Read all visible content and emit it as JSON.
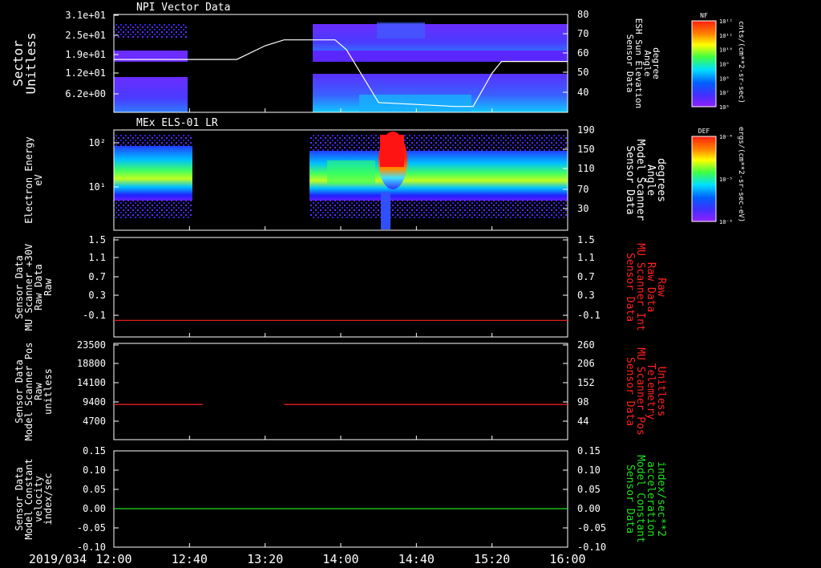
{
  "date_label": "2019/034",
  "time_ticks": [
    "12:00",
    "12:40",
    "13:20",
    "14:00",
    "14:40",
    "15:20",
    "16:00"
  ],
  "colors": {
    "red_series": "#ff2020",
    "green_series": "#20e020",
    "frame": "#ffffff",
    "background": "#000000"
  },
  "panels": [
    {
      "id": "npi",
      "title": "NPI Vector Data",
      "left_label": [
        "Sector",
        "Unitless"
      ],
      "left_ticks": [
        "3.1e+01",
        "2.5e+01",
        "1.9e+01",
        "1.2e+01",
        "6.2e+00"
      ],
      "right_label": [
        "Sensor Data",
        "ESH Sun Elevation",
        "Angle",
        "degree"
      ],
      "right_ticks": [
        "80",
        "70",
        "60",
        "50",
        "40"
      ],
      "colorbar": {
        "label": "NF",
        "unit": "cnts/(cm**2-sr-sec)",
        "ticks": [
          "10¹²",
          "10¹¹",
          "10¹⁰",
          "10⁹",
          "10⁸",
          "10⁷",
          "10⁶"
        ]
      }
    },
    {
      "id": "els",
      "title": "MEx ELS-01 LR",
      "left_label": [
        "Electron Energy",
        "eV"
      ],
      "left_ticks": [
        "10²",
        "10¹"
      ],
      "right_label": [
        "Sensor Data",
        "Model Scanner",
        "Angle",
        "degrees"
      ],
      "right_ticks": [
        "190",
        "150",
        "110",
        "70",
        "30"
      ],
      "colorbar": {
        "label": "DEF",
        "unit": "ergs/(cm**2-sr-sec-eV)",
        "ticks": [
          "10⁻⁴",
          "10⁻⁵",
          "10⁻⁶"
        ]
      }
    },
    {
      "id": "mu_raw",
      "title": "",
      "left_label": [
        "Sensor Data",
        "MU Scanner +30V",
        "Raw Data",
        "Raw"
      ],
      "left_ticks": [
        "1.5",
        "1.1",
        "0.7",
        "0.3",
        "-0.1"
      ],
      "right_label": [
        "Sensor Data",
        "MU Scanner Int",
        "Raw Data",
        "Raw"
      ],
      "right_ticks": [
        "1.5",
        "1.1",
        "0.7",
        "0.3",
        "-0.1"
      ]
    },
    {
      "id": "mu_pos",
      "title": "",
      "left_label": [
        "Sensor Data",
        "Model Scanner Pos",
        "Raw",
        "unitless"
      ],
      "left_ticks": [
        "23500",
        "18800",
        "14100",
        "9400",
        "4700"
      ],
      "right_label": [
        "Sensor Data",
        "MU Scanner Pos",
        "Telemetry",
        "Unitless"
      ],
      "right_ticks": [
        "260",
        "206",
        "152",
        "98",
        "44"
      ]
    },
    {
      "id": "model_const",
      "title": "",
      "left_label": [
        "Sensor Data",
        "Model Constant",
        "velocity",
        "index/sec"
      ],
      "left_ticks": [
        "0.15",
        "0.10",
        "0.05",
        "0.00",
        "-0.05",
        "-0.10"
      ],
      "right_label": [
        "Sensor Data",
        "Model Constant",
        "acceleration",
        "index/sec**2"
      ],
      "right_ticks": [
        "0.15",
        "0.10",
        "0.05",
        "0.00",
        "-0.05",
        "-0.10"
      ]
    }
  ],
  "chart_data": {
    "type": "line",
    "x_range": [
      "12:00",
      "16:00"
    ],
    "series": [
      {
        "panel": "npi",
        "axis": "right",
        "ylim": [
          30,
          80
        ],
        "x": [
          "12:00",
          "13:05",
          "13:20",
          "13:30",
          "13:57",
          "14:03",
          "14:20",
          "14:40",
          "15:00",
          "15:10",
          "15:20",
          "15:25",
          "16:00"
        ],
        "values": [
          57,
          57,
          64,
          67,
          67,
          62,
          35,
          34,
          33,
          33,
          50,
          56,
          56
        ]
      },
      {
        "panel": "mu_raw",
        "axis": "left",
        "ylim": [
          -0.3,
          1.5
        ],
        "x": [
          "12:00",
          "16:00"
        ],
        "values": [
          0.0,
          0.0
        ]
      },
      {
        "panel": "mu_pos",
        "axis": "left",
        "ylim": [
          0,
          23500
        ],
        "segments": [
          {
            "x": [
              "12:00",
              "12:47"
            ],
            "values": [
              8600,
              8600
            ]
          },
          {
            "x": [
              "13:30",
              "16:00"
            ],
            "values": [
              8600,
              8600
            ]
          }
        ]
      },
      {
        "panel": "model_const",
        "axis": "left",
        "ylim": [
          -0.1,
          0.15
        ],
        "x": [
          "12:00",
          "16:00"
        ],
        "values": [
          0.0,
          0.0
        ]
      }
    ],
    "spectrogram_coverage": [
      {
        "panel": "npi",
        "ranges": [
          [
            "12:00",
            "12:40"
          ],
          [
            "13:35",
            "16:00"
          ]
        ]
      },
      {
        "panel": "els",
        "ranges": [
          [
            "12:00",
            "12:41"
          ],
          [
            "13:35",
            "16:00"
          ]
        ]
      }
    ]
  }
}
